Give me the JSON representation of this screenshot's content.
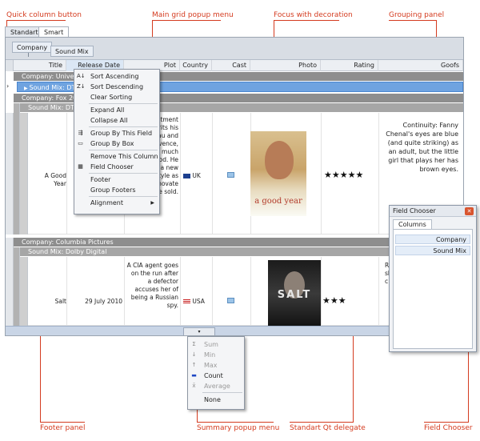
{
  "callouts": {
    "quick_column_button": "Quick column button",
    "main_grid_popup_menu": "Main grid popup menu",
    "focus_with_decoration": "Focus with decoration",
    "grouping_panel": "Grouping panel",
    "footer_panel": "Footer panel",
    "summary_popup_menu": "Summary popup menu",
    "standart_qt_delegate": "Standart Qt delegate",
    "field_chooser": "Field Chooser"
  },
  "tabs": [
    "Standart",
    "Smart"
  ],
  "grouping": {
    "chips": [
      "Company",
      "Sound Mix"
    ]
  },
  "columns": [
    "Title",
    "Release Date",
    "Plot",
    "Country",
    "Cast",
    "Photo",
    "Rating",
    "Goofs"
  ],
  "groups": {
    "g1": "Company: Universal P",
    "g1_sub": "Sound Mix: DTS,",
    "g2": "Company: Fox 2000 P",
    "g2_sub": "Sound Mix: DTS",
    "g3": "Company: Columbia Pictures",
    "g3_sub": "Sound Mix: Dolby Digital"
  },
  "rows": [
    {
      "title": "A Good Year",
      "plot_lines": [
        "investment",
        "herits his",
        "eau and",
        "rovence,",
        "ent much",
        "good. He",
        "s a new",
        "style as",
        "enovate",
        "e sold."
      ],
      "country": "UK",
      "poster_text": "a good year",
      "rating": "★★★★★",
      "goofs": "Continuity: Fanny Chenal's eyes are blue (and quite striking) as an adult, but the little girl that plays her has brown eyes."
    },
    {
      "title": "Salt",
      "release": "29 July 2010",
      "plot": "A CIA agent goes on the run after a defector accuses her of being a Russian spy.",
      "country": "USA",
      "poster_text": "SALT",
      "rating": "★★★",
      "goofs_lines": [
        "R",
        "sh",
        "c"
      ]
    }
  ],
  "main_menu": [
    {
      "icon": "sort-ascending-icon",
      "glyph": "A↓",
      "label": "Sort Ascending"
    },
    {
      "icon": "sort-descending-icon",
      "glyph": "Z↓",
      "label": "Sort Descending"
    },
    {
      "icon": "",
      "glyph": "",
      "label": "Clear Sorting"
    },
    {
      "icon": "",
      "glyph": "",
      "label": "Expand All"
    },
    {
      "icon": "",
      "glyph": "",
      "label": "Collapse All"
    },
    {
      "icon": "group-by-field-icon",
      "glyph": "⇶",
      "label": "Group By This Field"
    },
    {
      "icon": "group-by-box-icon",
      "glyph": "▭",
      "label": "Group By Box"
    },
    {
      "icon": "",
      "glyph": "",
      "label": "Remove This Column"
    },
    {
      "icon": "field-chooser-icon",
      "glyph": "▦",
      "label": "Field Chooser"
    },
    {
      "icon": "",
      "glyph": "",
      "label": "Footer"
    },
    {
      "icon": "",
      "glyph": "",
      "label": "Group Footers"
    },
    {
      "icon": "",
      "glyph": "",
      "label": "Alignment"
    }
  ],
  "summary_menu": [
    {
      "icon": "sum-icon",
      "glyph": "Σ",
      "label": "Sum",
      "enabled": false
    },
    {
      "icon": "min-icon",
      "glyph": "↓",
      "label": "Min",
      "enabled": false
    },
    {
      "icon": "max-icon",
      "glyph": "↑",
      "label": "Max",
      "enabled": false
    },
    {
      "icon": "count-icon",
      "glyph": "▬",
      "label": "Count",
      "enabled": true
    },
    {
      "icon": "average-icon",
      "glyph": "x̄",
      "label": "Average",
      "enabled": false
    },
    {
      "icon": "",
      "glyph": "",
      "label": "None",
      "enabled": true
    }
  ],
  "field_chooser": {
    "title": "Field Chooser",
    "tab": "Columns",
    "items": [
      "Company",
      "Sound Mix"
    ]
  },
  "colors": {
    "callout": "#d43b1f",
    "selection": "#6fa3e0",
    "group_row": "#8e8e8e",
    "footer": "#c9d5e6"
  }
}
